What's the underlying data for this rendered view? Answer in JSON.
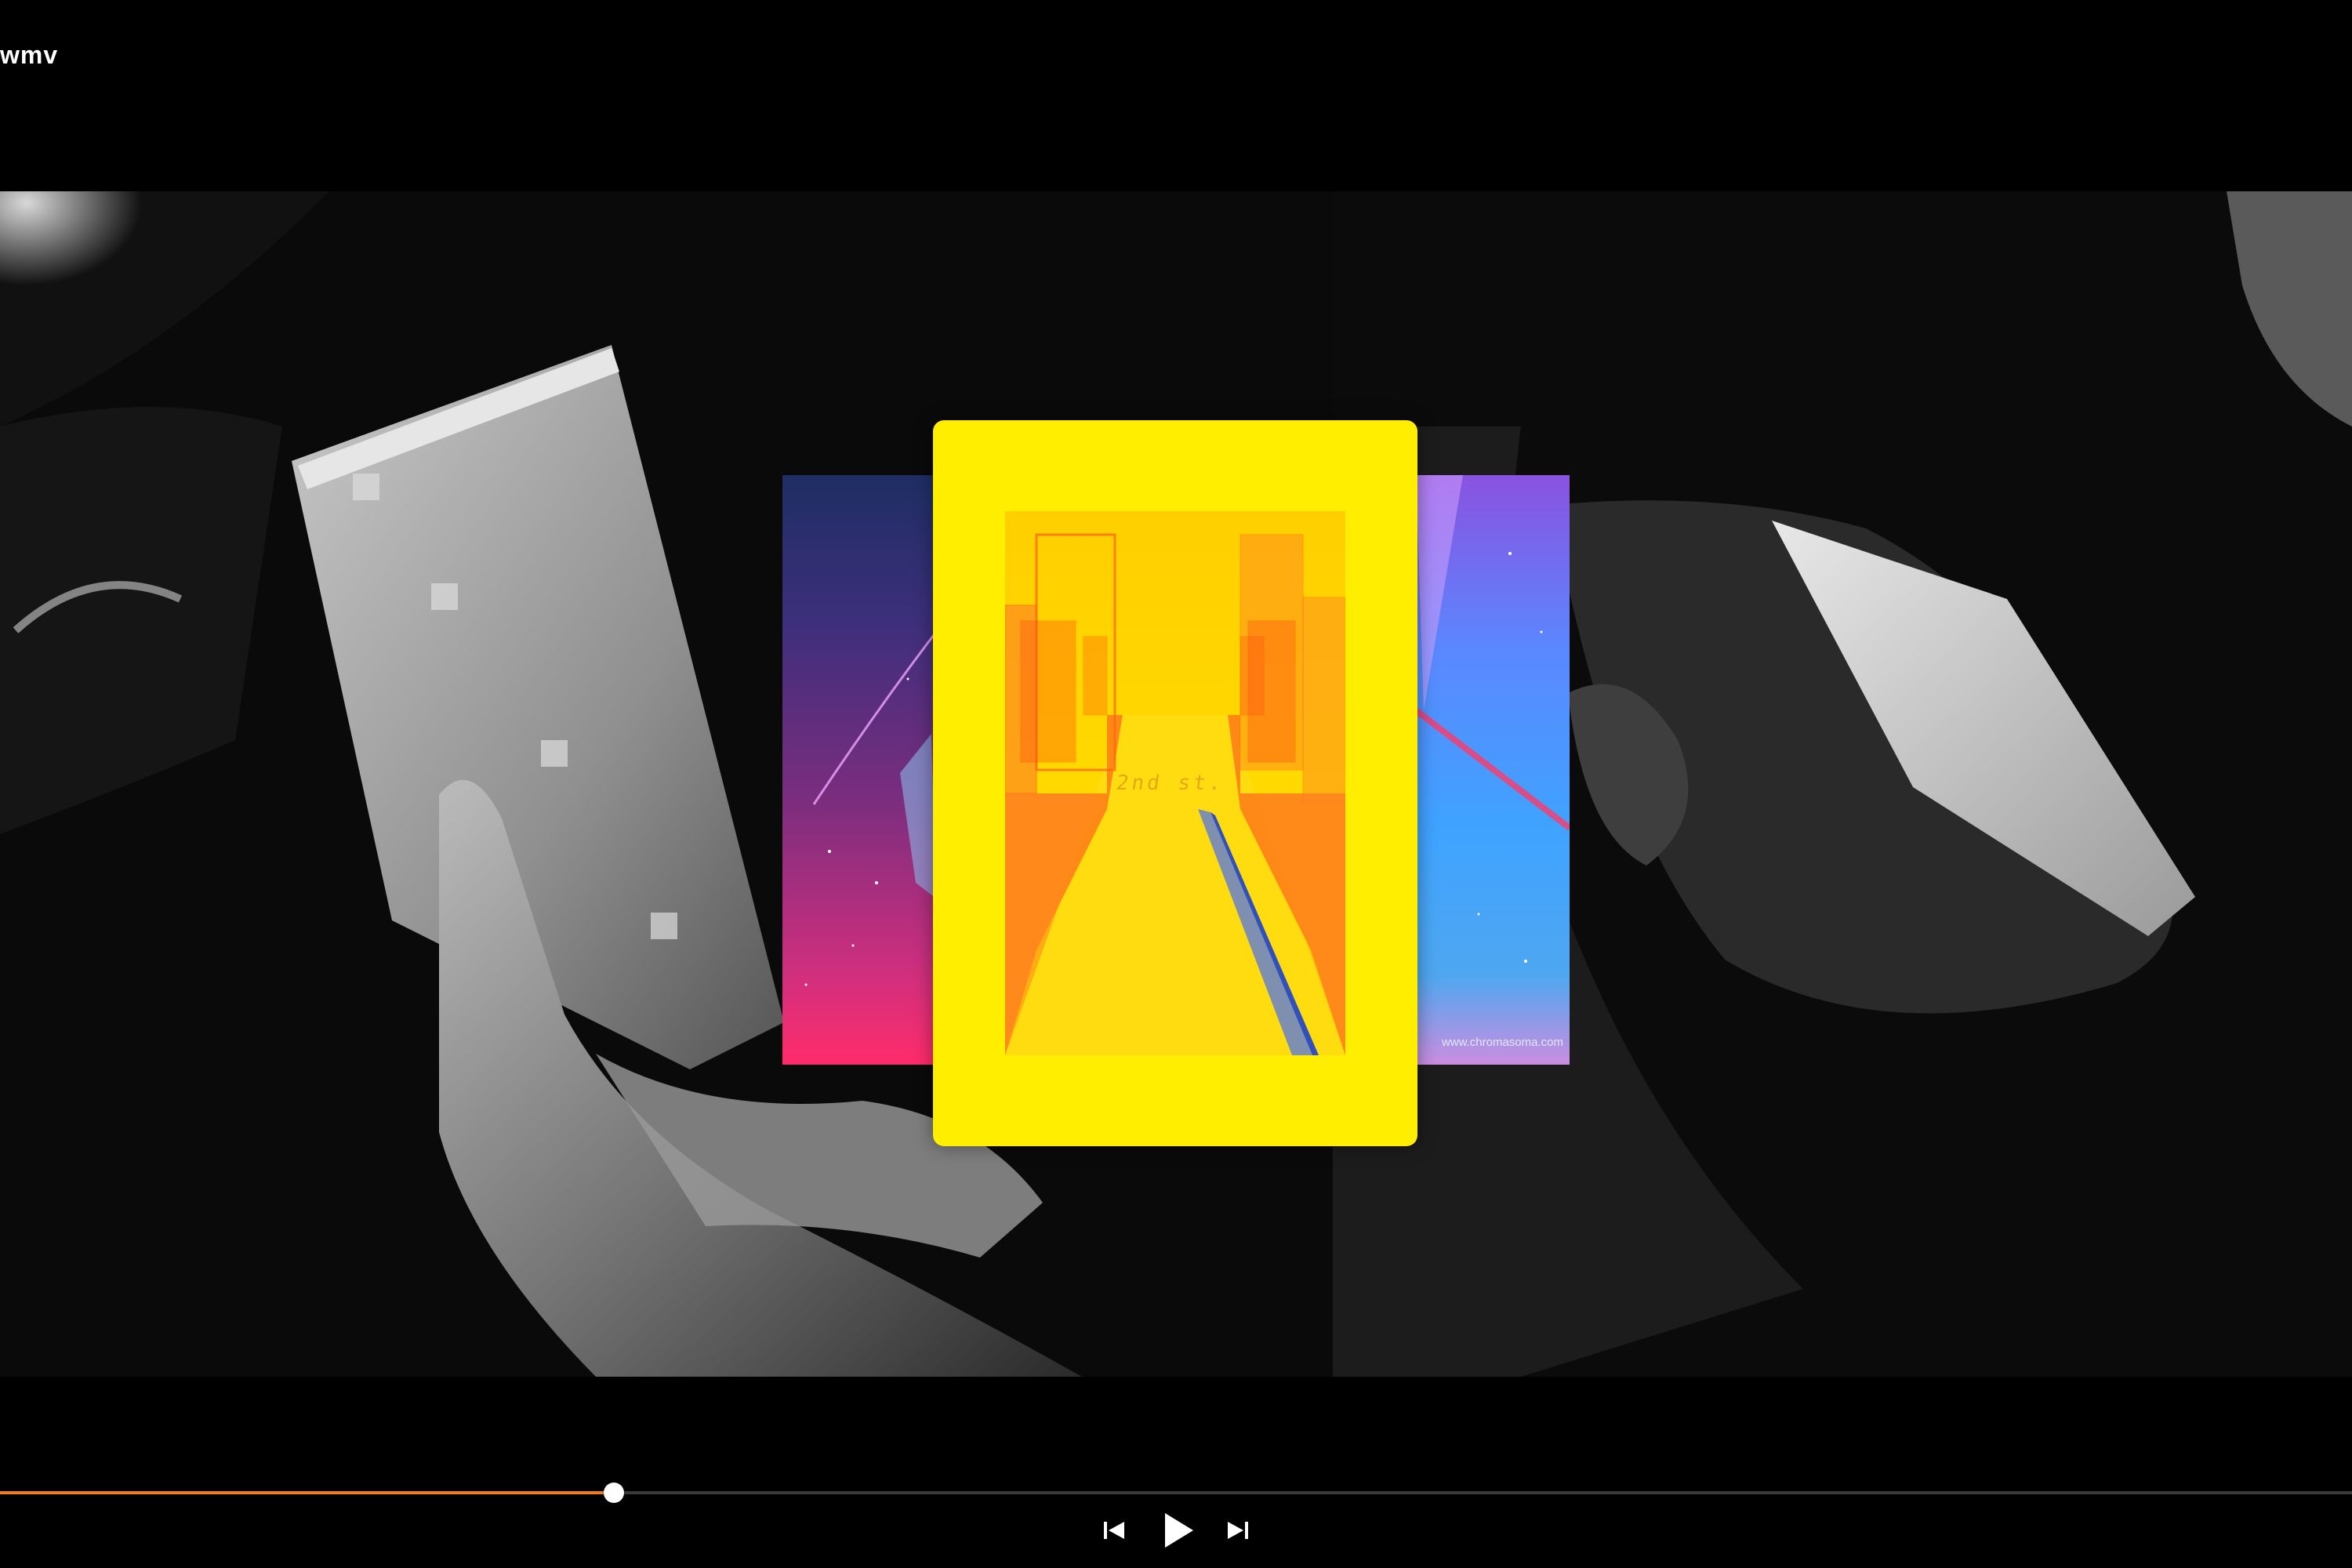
{
  "window": {
    "title": "wmv"
  },
  "video": {
    "frame_description_hidden": ""
  },
  "cards": {
    "main_street_label": "2nd st.",
    "right_watermark": "www.chromasoma.com"
  },
  "playback": {
    "progress": 0.261,
    "state": "paused"
  },
  "controls": {
    "previous_icon": "skip-previous-icon",
    "play_icon": "play-icon",
    "next_icon": "skip-next-icon"
  },
  "colors": {
    "accent": "#f47a20",
    "card_frame": "#ffee00",
    "background": "#000000"
  }
}
